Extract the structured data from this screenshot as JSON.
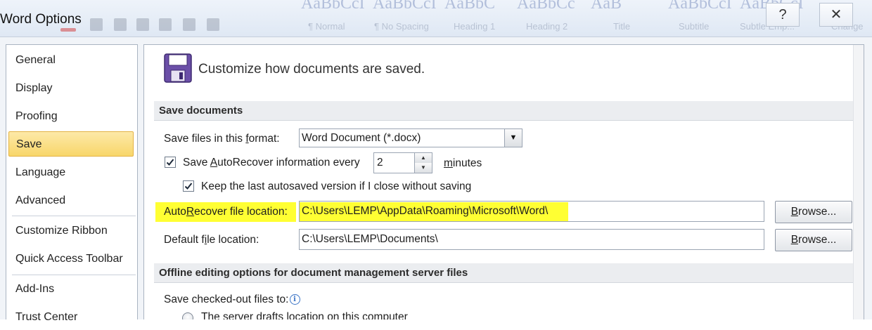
{
  "window": {
    "title": "Word Options",
    "help_icon": "question-icon",
    "close_icon": "close-icon"
  },
  "background_ribbon": {
    "styles": [
      "AaBbCcI",
      "AaBbCcI",
      "AaBbC",
      "AaBbCc",
      "AaB",
      "AaBbCcI",
      "AaBbCcI"
    ],
    "captions": [
      "¶ Normal",
      "¶ No Spacing",
      "Heading 1",
      "Heading 2",
      "Title",
      "Subtitle",
      "Subtle Emp...",
      "Change"
    ]
  },
  "sidebar": {
    "items": [
      {
        "label": "General"
      },
      {
        "label": "Display"
      },
      {
        "label": "Proofing"
      },
      {
        "label": "Save",
        "selected": true
      },
      {
        "label": "Language"
      },
      {
        "label": "Advanced"
      },
      {
        "label": "Customize Ribbon"
      },
      {
        "label": "Quick Access Toolbar"
      },
      {
        "label": "Add-Ins"
      },
      {
        "label": "Trust Center"
      }
    ]
  },
  "main": {
    "header_icon": "floppy-disk-icon",
    "heading": "Customize how documents are saved.",
    "save_documents": {
      "title": "Save documents",
      "format_label_pre": "Save files in this ",
      "format_label_key": "f",
      "format_label_post": "ormat:",
      "format_value": "Word Document (*.docx)",
      "autorecover_pre": "Save ",
      "autorecover_key": "A",
      "autorecover_post": "utoRecover information every",
      "autorecover_checked": true,
      "autorecover_minutes": "2",
      "minutes_key": "m",
      "minutes_post": "inutes",
      "keep_last_label": "Keep the last autosaved version if I close without saving",
      "keep_last_checked": true,
      "ar_location_pre": "Auto",
      "ar_location_key": "R",
      "ar_location_post": "ecover file location:",
      "ar_location_value": "C:\\Users\\LEMP\\AppData\\Roaming\\Microsoft\\Word\\",
      "default_location_pre": "Default f",
      "default_location_key": "i",
      "default_location_post": "le location:",
      "default_location_value": "C:\\Users\\LEMP\\Documents\\",
      "browse_key": "B",
      "browse_post": "rowse...",
      "highlight_color": "#ffff33"
    },
    "offline": {
      "title": "Offline editing options for document management server files",
      "checked_out_label": "Save checked-out files to:",
      "info_icon": "info-icon",
      "option_server_drafts": "The server drafts location on this computer"
    }
  }
}
